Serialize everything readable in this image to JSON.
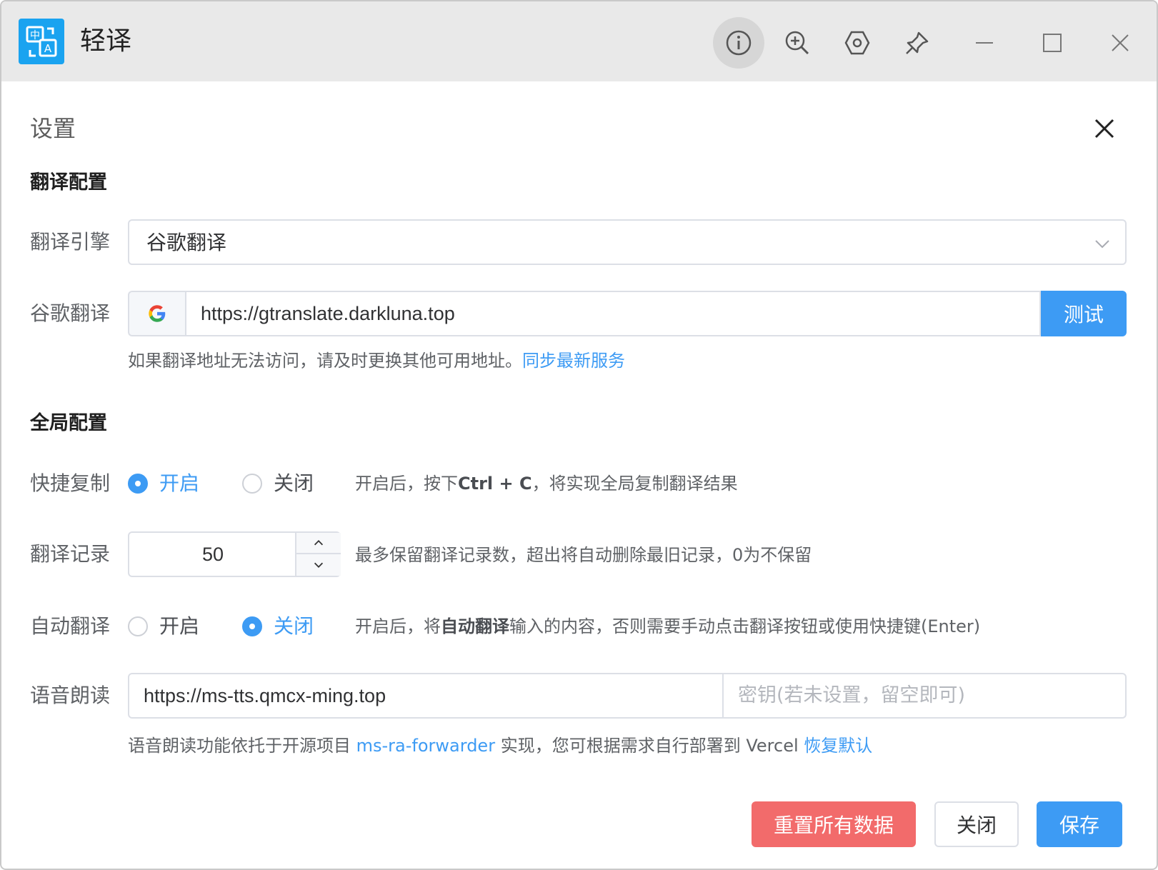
{
  "app": {
    "title": "轻译",
    "logo_icon": "translate-app-icon"
  },
  "titlebar": {
    "buttons": [
      "info-icon",
      "zoom-in-icon",
      "settings-hexagon-icon",
      "pin-icon",
      "minimize-icon",
      "maximize-icon",
      "close-icon"
    ]
  },
  "dialog": {
    "title": "设置"
  },
  "translate_section": {
    "title": "翻译配置",
    "engine_label": "翻译引擎",
    "engine_value": "谷歌翻译",
    "google_label": "谷歌翻译",
    "google_url": "https://gtranslate.darkluna.top",
    "test_button": "测试",
    "hint_text": "如果翻译地址无法访问，请及时更换其他可用地址。",
    "hint_link": "同步最新服务"
  },
  "global_section": {
    "title": "全局配置",
    "quick_copy": {
      "label": "快捷复制",
      "on_label": "开启",
      "off_label": "关闭",
      "selected": "on",
      "desc_prefix": "开启后，按下",
      "desc_bold": "Ctrl + C",
      "desc_suffix": "，将实现全局复制翻译结果"
    },
    "history": {
      "label": "翻译记录",
      "value": "50",
      "desc": "最多保留翻译记录数，超出将自动删除最旧记录，0为不保留"
    },
    "auto_translate": {
      "label": "自动翻译",
      "on_label": "开启",
      "off_label": "关闭",
      "selected": "off",
      "desc_prefix": "开启后，将",
      "desc_bold": "自动翻译",
      "desc_suffix": "输入的内容，否则需要手动点击翻译按钮或使用快捷键(Enter)"
    },
    "tts": {
      "label": "语音朗读",
      "url": "https://ms-tts.qmcx-ming.top",
      "key_placeholder": "密钥(若未设置，留空即可)",
      "hint_prefix": "语音朗读功能依托于开源项目",
      "hint_link": "ms-ra-forwarder",
      "hint_middle": "实现，您可根据需求自行部署到 Vercel",
      "hint_reset": "恢复默认"
    }
  },
  "footer": {
    "reset_all": "重置所有数据",
    "close": "关闭",
    "save": "保存"
  },
  "colors": {
    "primary": "#3d9bf4",
    "danger": "#f26b6b",
    "logo": "#1aa3f0"
  }
}
